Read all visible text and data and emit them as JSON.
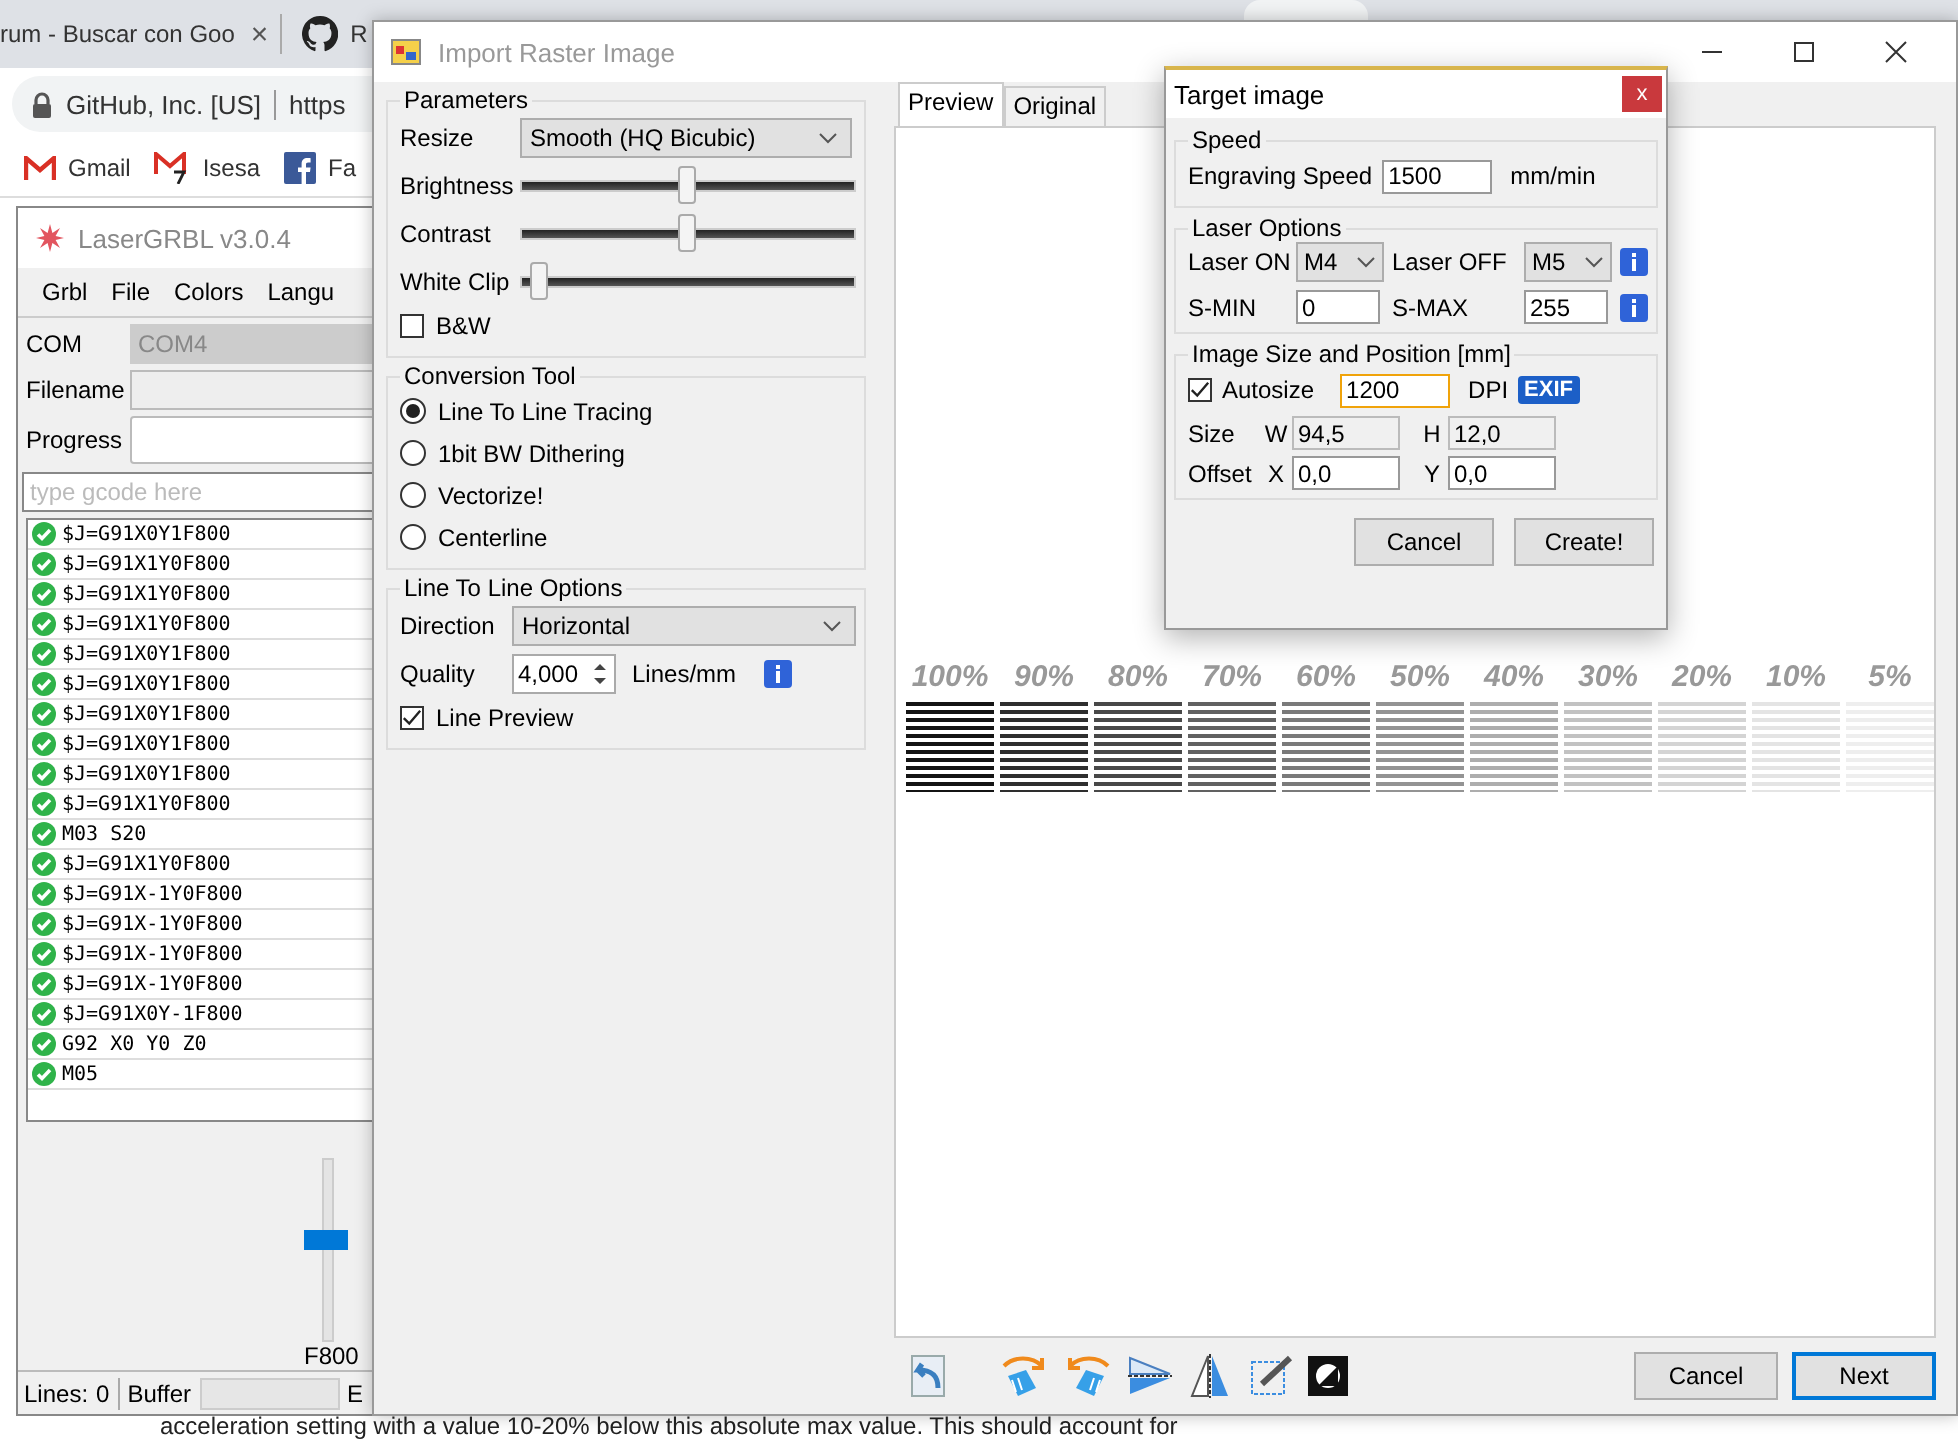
{
  "browser": {
    "tabs": [
      {
        "title": "rum - Buscar con Goo",
        "close": "×"
      },
      {
        "title": "R"
      }
    ],
    "site_identity": "GitHub, Inc. [US]",
    "url": "https",
    "bookmarks": [
      {
        "label": "Gmail",
        "kind": "mail"
      },
      {
        "label": "Isesa",
        "kind": "mailbadge"
      },
      {
        "label": "Fa",
        "kind": "squaref"
      }
    ],
    "page_text": "acceleration setting with a value 10-20% below this absolute max value. This should account for"
  },
  "lasergrbl": {
    "title": "LaserGRBL v3.0.4",
    "menu": [
      "Grbl",
      "File",
      "Colors",
      "Langu"
    ],
    "com_label": "COM",
    "com_value": "COM4",
    "filename_label": "Filename",
    "progress_label": "Progress",
    "gcode_placeholder": "type gcode here",
    "log": [
      "$J=G91X0Y1F800",
      "$J=G91X1Y0F800",
      "$J=G91X1Y0F800",
      "$J=G91X1Y0F800",
      "$J=G91X0Y1F800",
      "$J=G91X0Y1F800",
      "$J=G91X0Y1F800",
      "$J=G91X0Y1F800",
      "$J=G91X0Y1F800",
      "$J=G91X1Y0F800",
      "M03 S20",
      "$J=G91X1Y0F800",
      "$J=G91X-1Y0F800",
      "$J=G91X-1Y0F800",
      "$J=G91X-1Y0F800",
      "$J=G91X-1Y0F800",
      "$J=G91X0Y-1F800",
      "G92 X0 Y0 Z0",
      "M05"
    ],
    "speed_slider": {
      "level": 0.55
    },
    "speed_label": "F800",
    "status": {
      "lines_label": "Lines:",
      "lines_value": "0",
      "buffer_label": "Buffer",
      "next_label": "E"
    }
  },
  "import_dialog": {
    "title": "Import Raster Image",
    "parameters": {
      "title": "Parameters",
      "resize_label": "Resize",
      "resize_value": "Smooth (HQ Bicubic)",
      "sliders": [
        {
          "label": "Brightness",
          "level": 0.5
        },
        {
          "label": "Contrast",
          "level": 0.5
        },
        {
          "label": "White Clip",
          "level": 0.06
        }
      ],
      "bw": {
        "label": "B&W",
        "checked": false
      }
    },
    "conversion": {
      "title": "Conversion Tool",
      "options": [
        {
          "label": "Line To Line Tracing",
          "selected": true
        },
        {
          "label": "1bit BW Dithering",
          "selected": false
        },
        {
          "label": "Vectorize!",
          "selected": false
        },
        {
          "label": "Centerline",
          "selected": false
        }
      ]
    },
    "line_options": {
      "title": "Line To Line Options",
      "direction_label": "Direction",
      "direction_value": "Horizontal",
      "quality_label": "Quality",
      "quality_value": "4,000",
      "quality_unit": "Lines/mm",
      "line_preview": {
        "label": "Line Preview",
        "checked": true
      }
    },
    "tabs": [
      {
        "label": "Preview",
        "selected": true
      },
      {
        "label": "Original",
        "selected": false
      }
    ],
    "swatches": [
      {
        "label": "100%",
        "color": "#141414"
      },
      {
        "label": "90%",
        "color": "#2e2e2e"
      },
      {
        "label": "80%",
        "color": "#484848"
      },
      {
        "label": "70%",
        "color": "#616161"
      },
      {
        "label": "60%",
        "color": "#7a7a7a"
      },
      {
        "label": "50%",
        "color": "#939393"
      },
      {
        "label": "40%",
        "color": "#adadad"
      },
      {
        "label": "30%",
        "color": "#c2c2c2"
      },
      {
        "label": "20%",
        "color": "#d4d4d4"
      },
      {
        "label": "10%",
        "color": "#e4e4e4"
      },
      {
        "label": "5%",
        "color": "#eeeeee"
      }
    ],
    "buttons": [
      {
        "label": "Cancel",
        "default": false
      },
      {
        "label": "Next",
        "default": true
      }
    ]
  },
  "target_dialog": {
    "title": "Target image",
    "close": "x",
    "speed": {
      "title": "Speed",
      "label": "Engraving Speed",
      "value": "1500",
      "unit": "mm/min"
    },
    "laser": {
      "title": "Laser Options",
      "on_label": "Laser ON",
      "on_value": "M4",
      "off_label": "Laser OFF",
      "off_value": "M5",
      "smin_label": "S-MIN",
      "smin_value": "0",
      "smax_label": "S-MAX",
      "smax_value": "255"
    },
    "size": {
      "title": "Image Size and Position [mm]",
      "autosize": {
        "label": "Autosize",
        "checked": true
      },
      "dpi": {
        "value": "1200",
        "focused": true
      },
      "dpi_label": "DPI",
      "exif": "EXIF",
      "size_label": "Size",
      "offset_label": "Offset",
      "fields": [
        {
          "label": "W",
          "value": "94,5",
          "disabled": true
        },
        {
          "label": "H",
          "value": "12,0",
          "disabled": true
        },
        {
          "label": "X",
          "value": "0,0",
          "disabled": false
        },
        {
          "label": "Y",
          "value": "0,0",
          "disabled": false
        }
      ]
    },
    "buttons": [
      "Cancel",
      "Create!"
    ]
  }
}
